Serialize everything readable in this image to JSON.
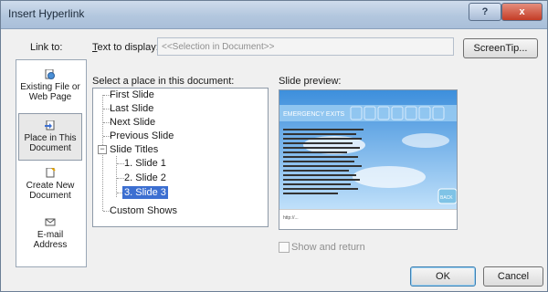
{
  "window": {
    "title": "Insert Hyperlink",
    "help_glyph": "?",
    "close_glyph": "x"
  },
  "link_to": {
    "label": "Link to:",
    "items": [
      {
        "label_line1": "Existing File or",
        "label_line2": "Web Page",
        "icon": "globe-document-icon"
      },
      {
        "label_line1": "Place in This",
        "label_line2": "Document",
        "icon": "place-document-icon",
        "selected": true
      },
      {
        "label_line1": "Create New",
        "label_line2": "Document",
        "icon": "new-document-icon"
      },
      {
        "label_line1": "E-mail",
        "label_line2": "Address",
        "icon": "email-icon"
      }
    ]
  },
  "text_to_display": {
    "label_u": "T",
    "label_rest": "ext to display:",
    "value": "<<Selection in Document>>"
  },
  "screentip_label": "ScreenTip...",
  "place": {
    "label": "Select a place in this document:",
    "items": [
      "First Slide",
      "Last Slide",
      "Next Slide",
      "Previous Slide",
      "Slide Titles",
      "1. Slide 1",
      "2. Slide 2",
      "3. Slide 3",
      "Custom Shows"
    ],
    "selected": "3. Slide 3"
  },
  "preview": {
    "label": "Slide preview:",
    "slide_heading": "EMERGENCY EXITS",
    "nav_button": "BACK",
    "footer": "http://..."
  },
  "show_and_return_label": "Show and return",
  "buttons": {
    "ok": "OK",
    "cancel": "Cancel"
  },
  "colors": {
    "selection": "#3c6fd1",
    "title_bar": "#b3c7de",
    "close": "#c43c26",
    "slide_sky": "#6aaee8"
  }
}
